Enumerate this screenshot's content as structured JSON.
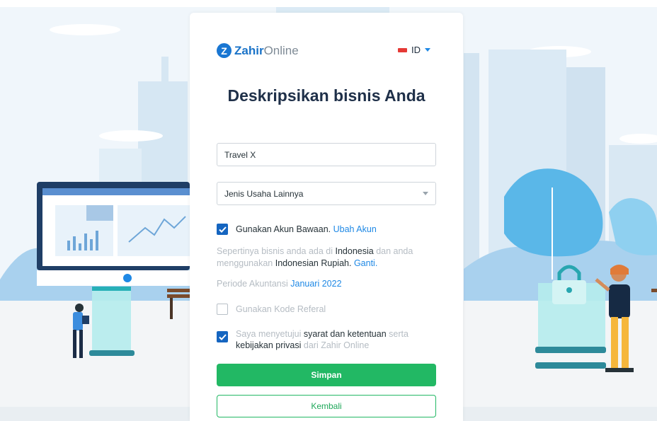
{
  "brand": {
    "logo_letter": "Z",
    "name_bold": "Zahir",
    "name_light": "Online"
  },
  "language": {
    "code": "ID",
    "flag_color": "#e53935"
  },
  "page_title": "Deskripsikan bisnis Anda",
  "business_name_input": {
    "value": "Travel X"
  },
  "business_type_select": {
    "value": "Jenis Usaha Lainnya"
  },
  "default_account": {
    "checked": true,
    "label": "Gunakan Akun Bawaan.",
    "link": "Ubah Akun"
  },
  "location_note": {
    "part1": "Sepertinya bisnis anda ada di",
    "country": "Indonesia",
    "part2": "dan anda menggunakan",
    "currency": "Indonesian Rupiah.",
    "link": "Ganti."
  },
  "accounting_period": {
    "label": "Periode Akuntansi",
    "value": "Januari 2022"
  },
  "referral": {
    "checked": false,
    "label": "Gunakan Kode Referal"
  },
  "agreement": {
    "checked": true,
    "part1": "Saya menyetujui",
    "terms": "syarat dan ketentuan",
    "part2": "serta",
    "privacy": "kebijakan privasi",
    "part3": "dari Zahir Online"
  },
  "buttons": {
    "save": "Simpan",
    "back": "Kembali"
  },
  "colors": {
    "primary_green": "#22b864",
    "brand_blue": "#1976d2",
    "checkbox_blue": "#1565c0",
    "title": "#1f3049"
  }
}
